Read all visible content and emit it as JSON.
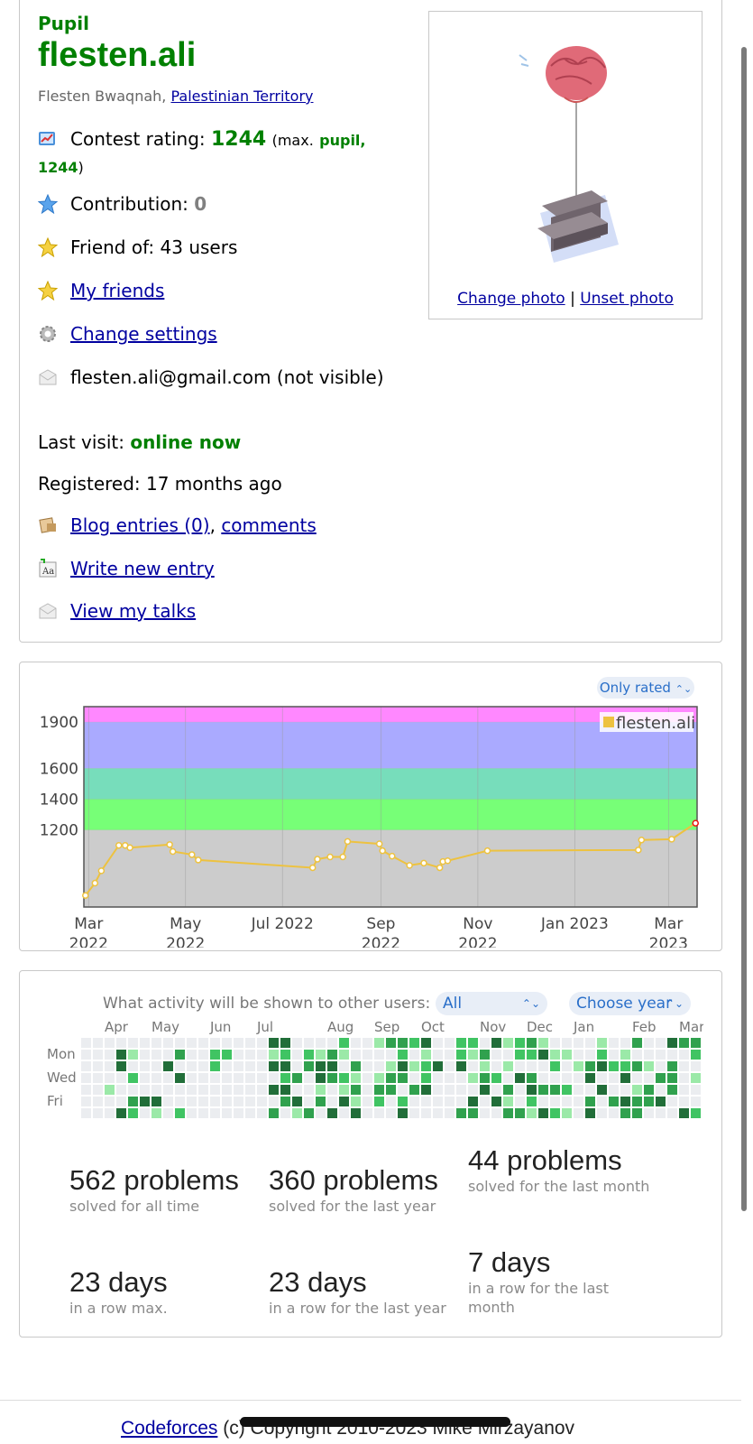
{
  "profile": {
    "rank": "Pupil",
    "handle": "flesten.ali",
    "fullname": "Flesten Bwaqnah,",
    "country": "Palestinian Territory",
    "rating_label": "Contest rating:",
    "rating": "1244",
    "max_prefix": "(max.",
    "max_rank": "pupil,",
    "max_rating": "1244",
    "max_suffix": ")",
    "contribution_label": "Contribution:",
    "contribution": "0",
    "friend_of": "Friend of: 43 users",
    "my_friends": "My friends",
    "change_settings": "Change settings",
    "email": "flesten.ali@gmail.com (not visible)",
    "last_visit_label": "Last visit:",
    "last_visit": "online now",
    "registered": "Registered: 17 months ago",
    "blog_entries": "Blog entries (0)",
    "comments": "comments",
    "write_entry": "Write new entry",
    "view_talks": "View my talks",
    "change_photo": "Change photo",
    "photo_separator": "|",
    "unset_photo": "Unset photo"
  },
  "rating_chart": {
    "filter_label": "Only rated",
    "legend": "flesten.ali"
  },
  "chart_data": {
    "type": "line",
    "title": "",
    "series": [
      {
        "name": "flesten.ali",
        "color": "#edc240",
        "x": [
          "2022-02-27",
          "2022-03-05",
          "2022-03-09",
          "2022-03-20",
          "2022-03-24",
          "2022-03-27",
          "2022-04-21",
          "2022-04-23",
          "2022-05-05",
          "2022-05-09",
          "2022-07-20",
          "2022-07-23",
          "2022-07-31",
          "2022-08-08",
          "2022-08-11",
          "2022-08-31",
          "2022-09-02",
          "2022-09-08",
          "2022-09-19",
          "2022-09-28",
          "2022-10-08",
          "2022-10-10",
          "2022-10-13",
          "2022-11-07",
          "2023-02-10",
          "2023-02-12",
          "2023-03-03",
          "2023-03-18"
        ],
        "y": [
          775,
          855,
          935,
          1100,
          1100,
          1085,
          1105,
          1060,
          1040,
          1005,
          955,
          1010,
          1025,
          1025,
          1125,
          1110,
          1065,
          1030,
          970,
          985,
          955,
          995,
          1000,
          1065,
          1070,
          1135,
          1140,
          1244
        ]
      }
    ],
    "bands": [
      {
        "from": 0,
        "to": 1200,
        "color": "#cccccc"
      },
      {
        "from": 1200,
        "to": 1400,
        "color": "#77ff77"
      },
      {
        "from": 1400,
        "to": 1600,
        "color": "#77ddbb"
      },
      {
        "from": 1600,
        "to": 1900,
        "color": "#aaaaff"
      },
      {
        "from": 1900,
        "to": 2000,
        "color": "#ff88ff"
      }
    ],
    "y_ticks": [
      "1200",
      "1400",
      "1600",
      "1900"
    ],
    "x_ticks": [
      {
        "line1": "Mar",
        "line2": "2022"
      },
      {
        "line1": "May",
        "line2": "2022"
      },
      {
        "line1": "Jul 2022",
        "line2": ""
      },
      {
        "line1": "Sep",
        "line2": "2022"
      },
      {
        "line1": "Nov",
        "line2": "2022"
      },
      {
        "line1": "Jan 2023",
        "line2": ""
      },
      {
        "line1": "Mar",
        "line2": "2023"
      }
    ],
    "grid": true,
    "legend_position": "top-right"
  },
  "activity": {
    "question": "What activity will be shown to other users:",
    "selected_visibility": "All",
    "year_label": "Choose year",
    "months": [
      "Apr",
      "May",
      "Jun",
      "Jul",
      "Aug",
      "Sep",
      "Oct",
      "Nov",
      "Dec",
      "Jan",
      "Feb",
      "Mar"
    ],
    "days": [
      "Mon",
      "Wed",
      "Fri"
    ]
  },
  "stats": [
    {
      "value": "562 problems",
      "label": "solved for all time"
    },
    {
      "value": "360 problems",
      "label": "solved for the last year"
    },
    {
      "value": "44 problems",
      "label": "solved for the last month"
    },
    {
      "value": "23 days",
      "label": "in a row max."
    },
    {
      "value": "23 days",
      "label": "in a row for the last year"
    },
    {
      "value": "7 days",
      "label": "in a row for the last month"
    }
  ],
  "footer": {
    "link": "Codeforces",
    "text": " (c) Copyright 2010-2023 Mike Mirzayanov"
  }
}
